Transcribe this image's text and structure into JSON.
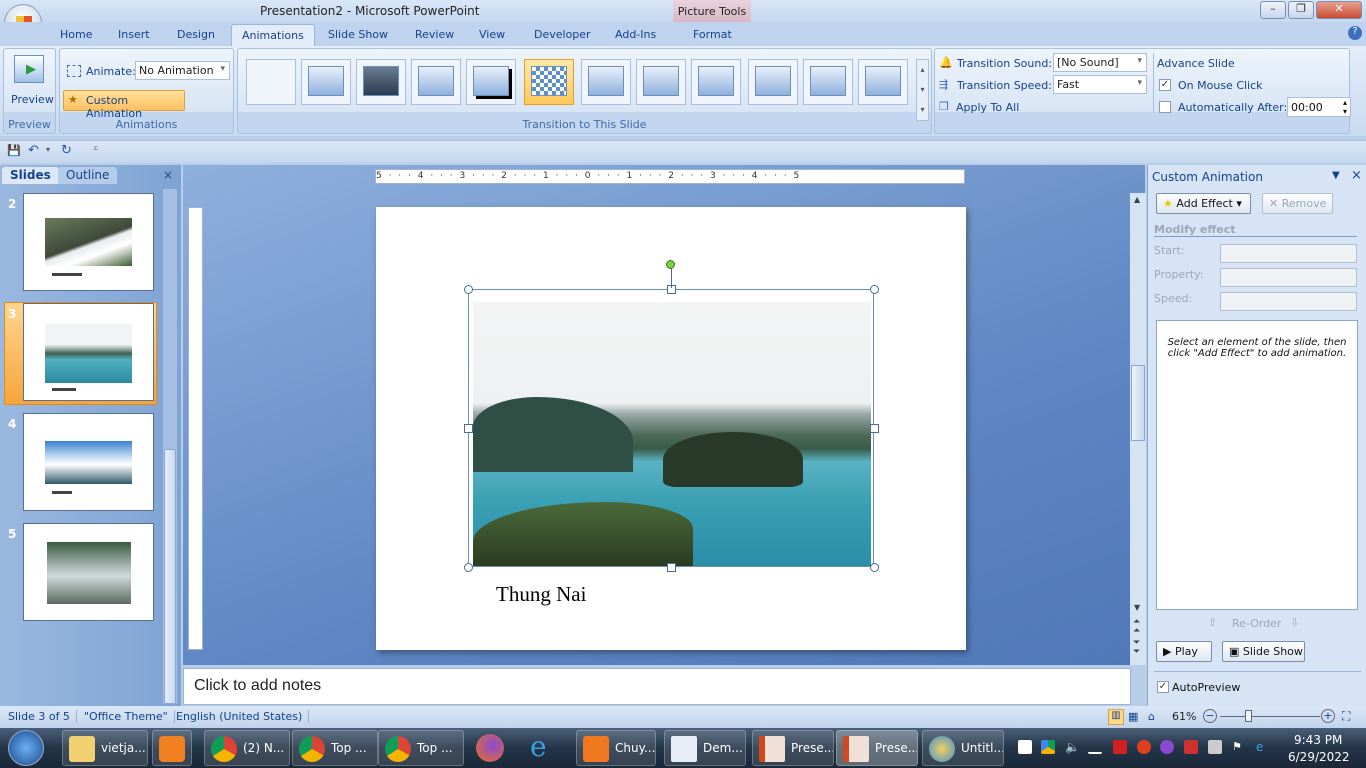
{
  "window": {
    "title": "Presentation2 - Microsoft PowerPoint",
    "context_tab_group": "Picture Tools"
  },
  "ribbon_tabs": [
    "Home",
    "Insert",
    "Design",
    "Animations",
    "Slide Show",
    "Review",
    "View",
    "Developer",
    "Add-Ins",
    "Format"
  ],
  "active_tab": "Animations",
  "preview_group": {
    "button": "Preview",
    "label": "Preview"
  },
  "animations_group": {
    "animate_label": "Animate:",
    "animate_value": "No Animation",
    "custom_animation": "Custom Animation",
    "label": "Animations"
  },
  "transition_group": {
    "label": "Transition to This Slide",
    "selected_index": 5,
    "sound_label": "Transition Sound:",
    "sound_value": "[No Sound]",
    "speed_label": "Transition Speed:",
    "speed_value": "Fast",
    "apply_all": "Apply To All"
  },
  "advance_group": {
    "title": "Advance Slide",
    "on_mouse_click": "On Mouse Click",
    "on_mouse_click_checked": true,
    "auto_after": "Automatically After:",
    "auto_after_checked": false,
    "auto_after_value": "00:00"
  },
  "left_pane": {
    "tabs": [
      "Slides",
      "Outline"
    ],
    "slides": [
      {
        "number": "2"
      },
      {
        "number": "3",
        "selected": true
      },
      {
        "number": "4"
      },
      {
        "number": "5"
      }
    ]
  },
  "ruler": {
    "horizontal": "5 · · · 4 · · · 3 · · · 2 · · · 1 · · · 0 · · · 1 · · · 2 · · · 3 · · · 4 · · · 5"
  },
  "slide": {
    "caption": "Thung Nai"
  },
  "notes": {
    "placeholder": "Click to add notes"
  },
  "custom_animation_pane": {
    "title": "Custom Animation",
    "add_effect": "Add Effect",
    "remove": "Remove",
    "modify_effect": "Modify effect",
    "start": "Start:",
    "property": "Property:",
    "speed": "Speed:",
    "hint": "Select an element of the slide, then click \"Add Effect\" to add animation.",
    "reorder": "Re-Order",
    "play": "Play",
    "slide_show": "Slide Show",
    "autopreview": "AutoPreview",
    "autopreview_checked": true
  },
  "status_bar": {
    "slide": "Slide 3 of 5",
    "theme": "\"Office Theme\"",
    "language": "English (United States)",
    "zoom": "61%",
    "zoom_percent": 61
  },
  "taskbar": {
    "items": [
      "vietja...",
      "(2) N...",
      "Top ...",
      "Top ...",
      "Chuy...",
      "Dem...",
      "Prese...",
      "Prese...",
      "Untitl..."
    ],
    "time": "9:43 PM",
    "date": "6/29/2022"
  },
  "colors": {
    "accent": "#15428b",
    "selected_slide": "#f5a53a",
    "ribbon": "#c9daf0"
  }
}
